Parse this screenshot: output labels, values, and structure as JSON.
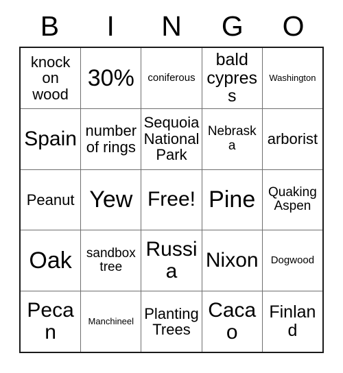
{
  "card": {
    "title_letters": [
      "B",
      "I",
      "N",
      "G",
      "O"
    ],
    "free_space_label": "Free!",
    "border_color": "#1a1a1a",
    "grid_line_color": "#6e6e6e",
    "background_color": "#ffffff",
    "text_color": "#000000",
    "rows": 5,
    "columns": 5,
    "cells": [
      [
        {
          "text": "knock\non\nwood",
          "size": "fs-lg"
        },
        {
          "text": "30%",
          "size": "fs-huge"
        },
        {
          "text": "coniferous",
          "size": "fs-sm"
        },
        {
          "text": "bald\ncypress",
          "size": "fs-xl"
        },
        {
          "text": "Washington",
          "size": "fs-xs"
        }
      ],
      [
        {
          "text": "Spain",
          "size": "fs-xxl"
        },
        {
          "text": "number\nof rings",
          "size": "fs-lg"
        },
        {
          "text": "Sequoia\nNational\nPark",
          "size": "fs-lg"
        },
        {
          "text": "Nebraska",
          "size": "fs-md"
        },
        {
          "text": "arborist",
          "size": "fs-lg"
        }
      ],
      [
        {
          "text": "Peanut",
          "size": "fs-lg"
        },
        {
          "text": "Yew",
          "size": "fs-huge"
        },
        {
          "text": "Free!",
          "size": "fs-xxl"
        },
        {
          "text": "Pine",
          "size": "fs-huge"
        },
        {
          "text": "Quaking\nAspen",
          "size": "fs-md"
        }
      ],
      [
        {
          "text": "Oak",
          "size": "fs-huge"
        },
        {
          "text": "sandbox\ntree",
          "size": "fs-md"
        },
        {
          "text": "Russia",
          "size": "fs-xxl"
        },
        {
          "text": "Nixon",
          "size": "fs-xxl"
        },
        {
          "text": "Dogwood",
          "size": "fs-sm"
        }
      ],
      [
        {
          "text": "Pecan",
          "size": "fs-xxl"
        },
        {
          "text": "Manchineel",
          "size": "fs-xs"
        },
        {
          "text": "Planting\nTrees",
          "size": "fs-lg"
        },
        {
          "text": "Cacao",
          "size": "fs-xxl"
        },
        {
          "text": "Finland",
          "size": "fs-xl"
        }
      ]
    ]
  }
}
